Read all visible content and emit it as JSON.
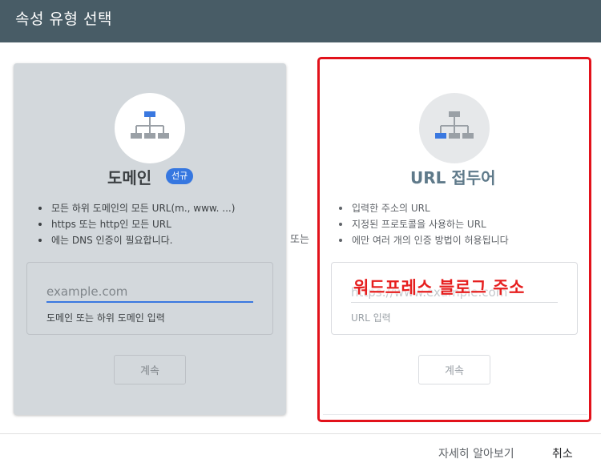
{
  "header": {
    "title": "속성 유형 선택"
  },
  "domain_card": {
    "title": "도메인",
    "badge": "선규",
    "bullets": [
      "모든 하위 도메인의 모든 URL(m., www. ...)",
      "https 또는 http인 모든 URL",
      "에는 DNS 인증이 필요합니다."
    ],
    "input_placeholder": "example.com",
    "input_value": "",
    "helper": "도메인 또는 하위 도메인 입력",
    "button_label": "계속"
  },
  "separator": {
    "label": "또는"
  },
  "url_card": {
    "title": "URL 접두어",
    "bullets": [
      "입력한 주소의 URL",
      "지정된 프로토콜을 사용하는 URL",
      "에만 여러 개의 인증 방법이 허용됩니다"
    ],
    "input_placeholder": "https://www.example.com",
    "input_value": "",
    "helper": "URL 입력",
    "overlay_annotation": "워드프레스 블로그 주소",
    "button_label": "계속"
  },
  "footer": {
    "learn_more": "자세히 알아보기",
    "cancel": "취소"
  },
  "colors": {
    "header": "#485c66",
    "accent": "#3677e0",
    "highlight": "#e2121b",
    "domain_card_bg": "#d3d8dc"
  }
}
